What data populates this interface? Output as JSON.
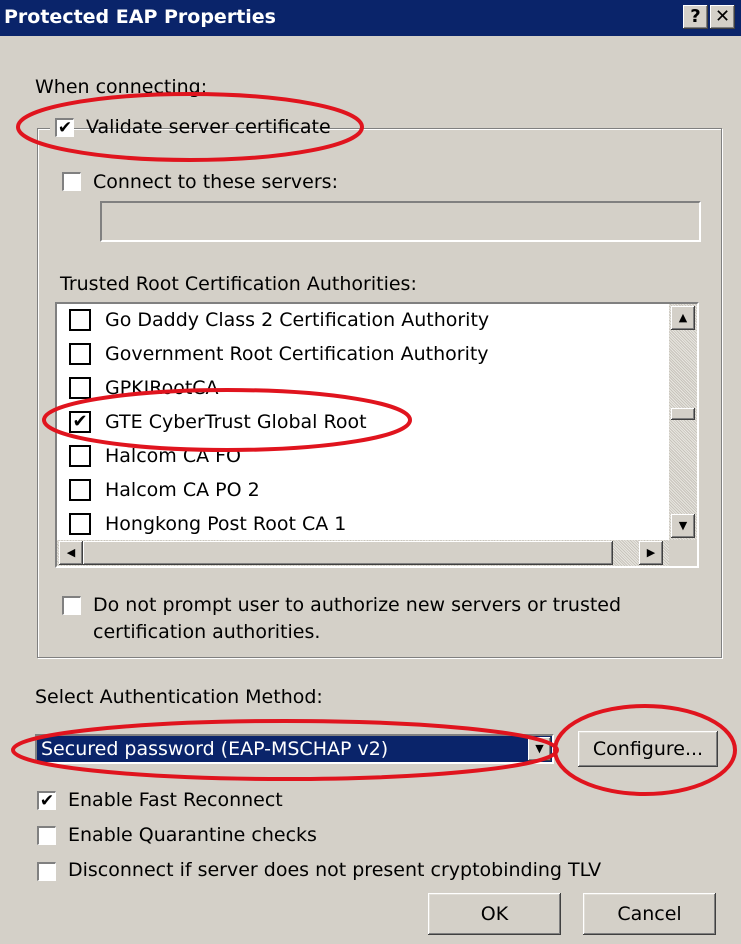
{
  "window": {
    "title": "Protected EAP Properties",
    "help_button": "?",
    "close_button": "✕"
  },
  "when_connecting_label": "When connecting:",
  "validate_cert": {
    "label": "Validate server certificate",
    "checked": true
  },
  "connect_servers": {
    "label": "Connect to these servers:",
    "checked": false,
    "value": ""
  },
  "trusted_root_label": "Trusted Root Certification Authorities:",
  "cert_list": [
    {
      "label": "Go Daddy Class 2 Certification Authority",
      "checked": false
    },
    {
      "label": "Government Root Certification Authority",
      "checked": false
    },
    {
      "label": "GPKIRootCA",
      "checked": false
    },
    {
      "label": "GTE CyberTrust Global Root",
      "checked": true
    },
    {
      "label": "Halcom CA FO",
      "checked": false
    },
    {
      "label": "Halcom CA PO 2",
      "checked": false
    },
    {
      "label": "Hongkong Post Root CA 1",
      "checked": false
    }
  ],
  "do_not_prompt": {
    "label_line1": "Do not prompt user to authorize new servers or trusted",
    "label_line2": "certification authorities.",
    "checked": false
  },
  "auth_method_label": "Select Authentication Method:",
  "auth_method_selected": "Secured password (EAP-MSCHAP v2)",
  "configure_button": "Configure...",
  "options": [
    {
      "label": "Enable Fast Reconnect",
      "checked": true
    },
    {
      "label": "Enable Quarantine checks",
      "checked": false
    },
    {
      "label": "Disconnect if server does not present cryptobinding TLV",
      "checked": false
    }
  ],
  "ok_button": "OK",
  "cancel_button": "Cancel",
  "colors": {
    "titlebar": "#0a246a",
    "dialog_bg": "#d4d0c8",
    "annotation": "#e0141e",
    "selection": "#0a246a"
  }
}
